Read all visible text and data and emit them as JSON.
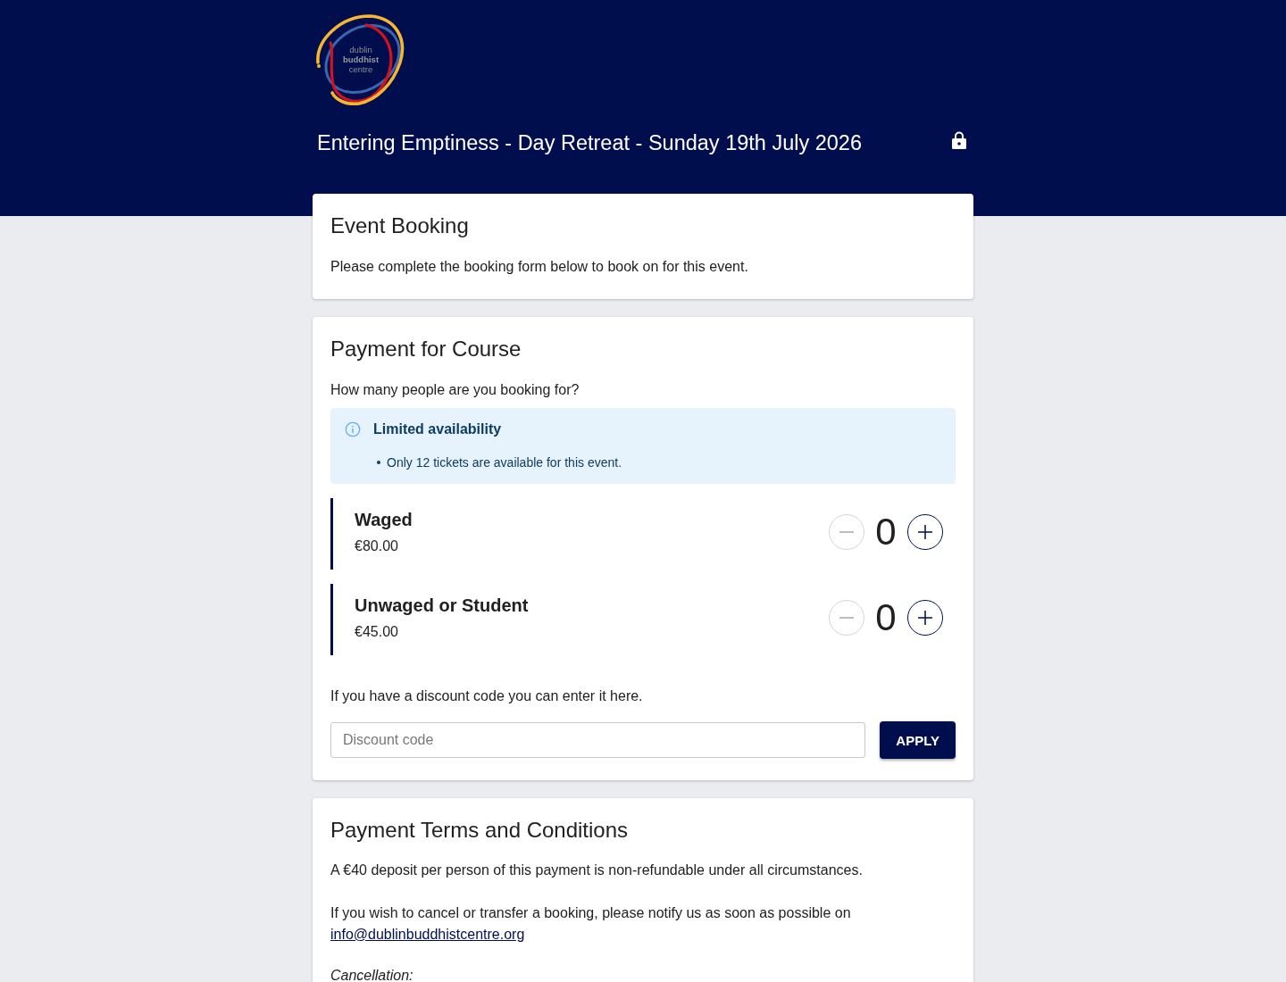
{
  "header": {
    "logo": {
      "lines": [
        "dublin",
        "buddhist",
        "centre"
      ]
    },
    "title": "Entering Emptiness - Day Retreat - Sunday 19th July 2026"
  },
  "event_booking": {
    "heading": "Event Booking",
    "text": "Please complete the booking form below to book on for this event."
  },
  "payment": {
    "heading": "Payment for Course",
    "question": "How many people are you booking for?",
    "notice": {
      "title": "Limited availability",
      "items": [
        "Only 12 tickets are available for this event."
      ]
    },
    "tickets": [
      {
        "name": "Waged",
        "price": "€80.00",
        "count": "0",
        "minus_disabled": true,
        "plus_disabled": false
      },
      {
        "name": "Unwaged or Student",
        "price": "€45.00",
        "count": "0",
        "minus_disabled": true,
        "plus_disabled": false
      }
    ],
    "discount": {
      "prompt": "If you have a discount code you can enter it here.",
      "placeholder": "Discount code",
      "button": "APPLY"
    }
  },
  "terms": {
    "heading": "Payment Terms and Conditions",
    "paragraphs": [
      {
        "kind": "text",
        "text": "A €40 deposit per person of this payment is non-refundable under all circumstances."
      },
      {
        "kind": "text_link",
        "text": "If you wish to cancel or transfer a booking, please notify us as soon as possible on",
        "link": "info@dublinbuddhistcentre.org"
      },
      {
        "kind": "subheading",
        "text": "Cancellation:"
      }
    ]
  }
}
